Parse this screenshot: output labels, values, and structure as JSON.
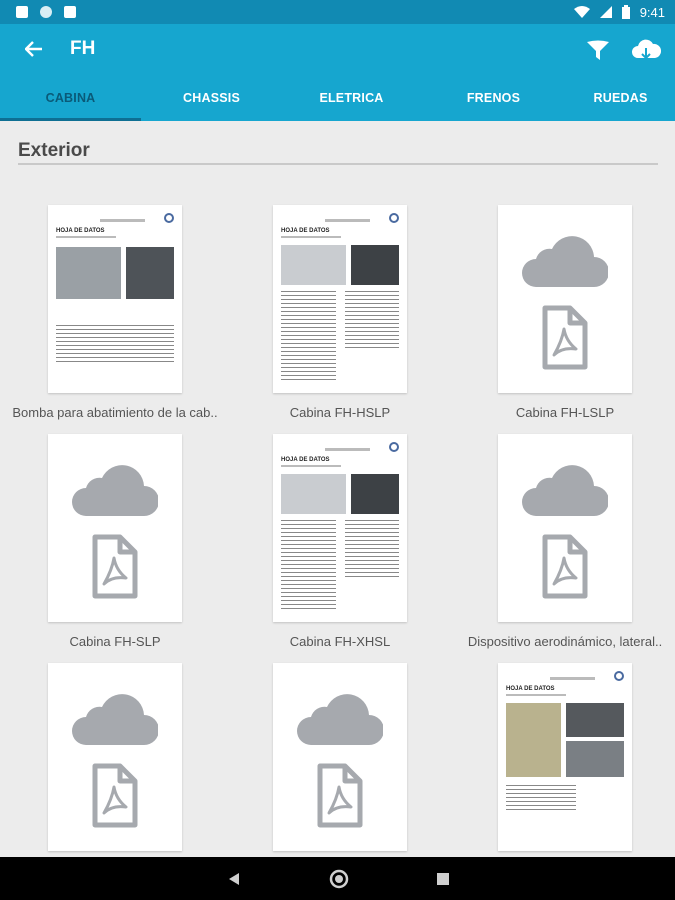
{
  "status": {
    "time": "9:41"
  },
  "header": {
    "title": "FH",
    "back_icon": "arrow-left-icon",
    "filter_icon": "filter-icon",
    "download_icon": "cloud-download-icon"
  },
  "tabs": [
    {
      "label": "CABINA",
      "active": true
    },
    {
      "label": "CHASSIS",
      "active": false
    },
    {
      "label": "ELETRICA",
      "active": false
    },
    {
      "label": "FRENOS",
      "active": false
    },
    {
      "label": "RUEDAS",
      "active": false
    }
  ],
  "section": {
    "title": "Exterior"
  },
  "documents": [
    {
      "caption": "Bomba para abatimiento de la cab..",
      "preview": "document",
      "doc_title": "HOJA DE DATOS"
    },
    {
      "caption": "Cabina FH-HSLP",
      "preview": "document",
      "doc_title": "HOJA DE DATOS"
    },
    {
      "caption": "Cabina FH-LSLP",
      "preview": "cloud-pdf"
    },
    {
      "caption": "Cabina FH-SLP",
      "preview": "cloud-pdf"
    },
    {
      "caption": "Cabina FH-XHSL",
      "preview": "document",
      "doc_title": "HOJA DE DATOS"
    },
    {
      "caption": "Dispositivo aerodinámico, lateral..",
      "preview": "cloud-pdf"
    },
    {
      "caption": "",
      "preview": "cloud-pdf"
    },
    {
      "caption": "",
      "preview": "cloud-pdf"
    },
    {
      "caption": "",
      "preview": "document",
      "doc_title": "HOJA DE DATOS"
    }
  ],
  "colors": {
    "primary": "#16a6cf",
    "status_bar": "#118ab3",
    "active_tab": "#0a5a78",
    "placeholder": "#a6a9ae"
  }
}
